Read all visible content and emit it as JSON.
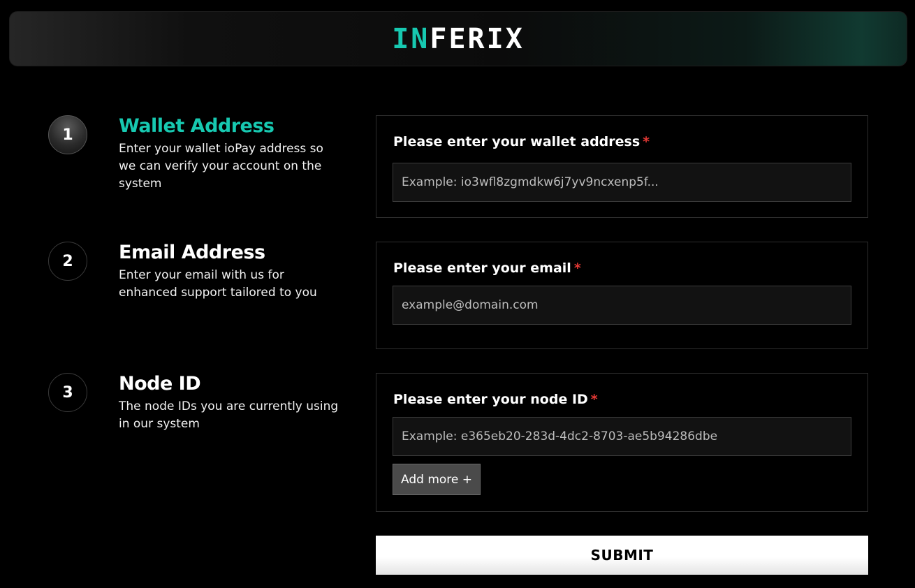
{
  "header": {
    "logo_accent": "IN",
    "logo_rest": "FERIX"
  },
  "steps": [
    {
      "number": "1",
      "title": "Wallet Address",
      "description": "Enter your wallet ioPay address so we can verify your account on the system",
      "active": true
    },
    {
      "number": "2",
      "title": "Email Address",
      "description": "Enter your email with us for enhanced support tailored to you",
      "active": false
    },
    {
      "number": "3",
      "title": "Node ID",
      "description": "The node IDs you are currently using in our system",
      "active": false
    }
  ],
  "form": {
    "required_mark": "*",
    "wallet": {
      "label": "Please enter your wallet address",
      "placeholder": "Example: io3wfl8zgmdkw6j7yv9ncxenp5f...",
      "value": ""
    },
    "email": {
      "label": "Please enter your email",
      "placeholder": "example@domain.com",
      "value": ""
    },
    "node": {
      "label": "Please enter your node ID",
      "placeholder": "Example: e365eb20-283d-4dc2-8703-ae5b94286dbe",
      "value": "",
      "add_more_label": "Add more +"
    },
    "submit_label": "SUBMIT"
  },
  "colors": {
    "accent": "#17c9b1",
    "required": "#e53935",
    "background": "#000000"
  }
}
